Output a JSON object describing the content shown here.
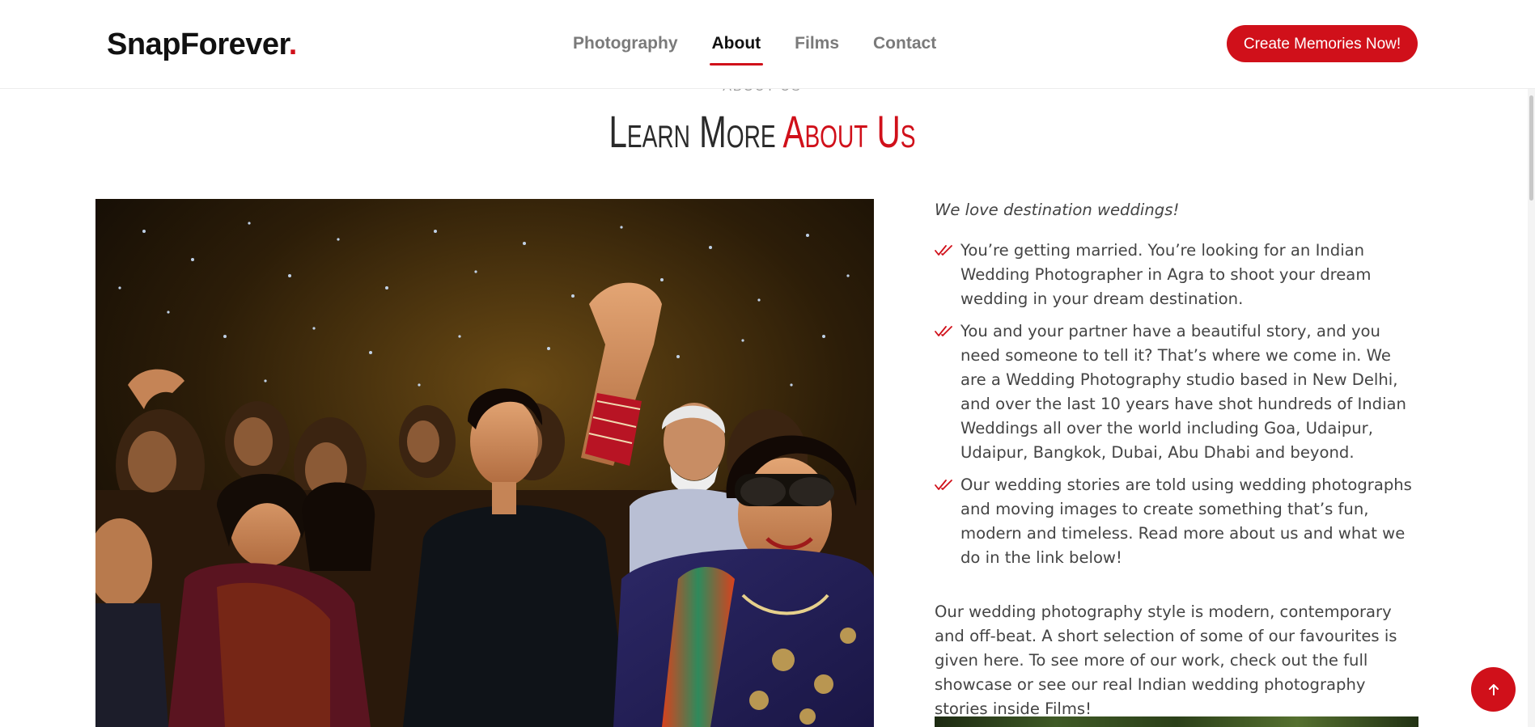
{
  "header": {
    "logo_text": "SnapForever",
    "logo_dot": ".",
    "nav": [
      {
        "label": "Photography",
        "active": false
      },
      {
        "label": "About",
        "active": true
      },
      {
        "label": "Films",
        "active": false
      },
      {
        "label": "Contact",
        "active": false
      }
    ],
    "cta_label": "Create Memories Now!"
  },
  "section": {
    "eyebrow": "ABOUT US",
    "title_main": "Learn More ",
    "title_accent": "About Us"
  },
  "content": {
    "tagline": "We love destination weddings!",
    "bullets": [
      "You’re getting married. You’re looking for an Indian Wedding Photographer in Agra to shoot your dream wedding in your dream destination.",
      "You and your partner have a beautiful story, and you need someone to tell it? That’s where we come in. We are a Wedding Photography studio based in New Delhi, and over the last 10 years have shot hundreds of Indian Weddings all over the world including Goa, Udaipur, Udaipur, Bangkok, Dubai, Abu Dhabi and beyond.",
      "Our wedding stories are told using wedding photographs and moving images to create something that’s fun, modern and timeless. Read more about us and what we do in the link below!"
    ],
    "paragraph": "Our wedding photography style is modern, contemporary and off-beat. A short selection of some of our favourites is given here. To see more of our work, check out the full showcase or see our real Indian wedding photography stories inside Films!"
  },
  "icons": {
    "bullet": "double-check-icon",
    "back_to_top": "arrow-up-icon"
  },
  "colors": {
    "accent": "#d0101a",
    "text": "#444444",
    "heading": "#2a2a2a"
  }
}
